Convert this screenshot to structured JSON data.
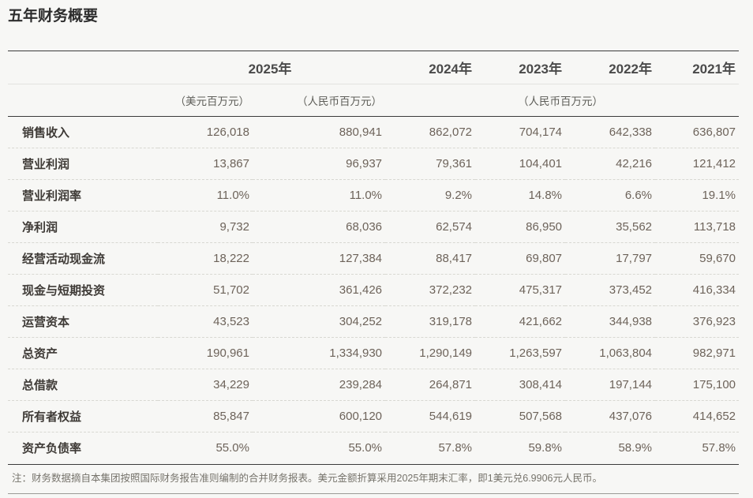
{
  "page": {
    "title": "五年财务概要"
  },
  "table": {
    "header": {
      "year_2025": "2025年",
      "years": [
        "2024年",
        "2023年",
        "2022年",
        "2021年"
      ],
      "unit_usd": "（美元百万元）",
      "unit_rmb_2025": "（人民币百万元）",
      "unit_rmb_prior": "（人民币百万元）"
    },
    "rows": [
      {
        "label": "销售收入",
        "values": [
          "126,018",
          "880,941",
          "862,072",
          "704,174",
          "642,338",
          "636,807"
        ]
      },
      {
        "label": "营业利润",
        "values": [
          "13,867",
          "96,937",
          "79,361",
          "104,401",
          "42,216",
          "121,412"
        ]
      },
      {
        "label": "营业利润率",
        "values": [
          "11.0%",
          "11.0%",
          "9.2%",
          "14.8%",
          "6.6%",
          "19.1%"
        ]
      },
      {
        "label": "净利润",
        "values": [
          "9,732",
          "68,036",
          "62,574",
          "86,950",
          "35,562",
          "113,718"
        ]
      },
      {
        "label": "经营活动现金流",
        "values": [
          "18,222",
          "127,384",
          "88,417",
          "69,807",
          "17,797",
          "59,670"
        ]
      },
      {
        "label": "现金与短期投资",
        "values": [
          "51,702",
          "361,426",
          "372,232",
          "475,317",
          "373,452",
          "416,334"
        ]
      },
      {
        "label": "运营资本",
        "values": [
          "43,523",
          "304,252",
          "319,178",
          "421,662",
          "344,938",
          "376,923"
        ]
      },
      {
        "label": "总资产",
        "values": [
          "190,961",
          "1,334,930",
          "1,290,149",
          "1,263,597",
          "1,063,804",
          "982,971"
        ]
      },
      {
        "label": "总借款",
        "values": [
          "34,229",
          "239,284",
          "264,871",
          "308,414",
          "197,144",
          "175,100"
        ]
      },
      {
        "label": "所有者权益",
        "values": [
          "85,847",
          "600,120",
          "544,619",
          "507,568",
          "437,076",
          "414,652"
        ]
      },
      {
        "label": "资产负债率",
        "values": [
          "55.0%",
          "55.0%",
          "57.8%",
          "59.8%",
          "58.9%",
          "57.8%"
        ]
      }
    ]
  },
  "footnote": "注：财务数据摘自本集团按照国际财务报告准则编制的合并财务报表。美元金额折算采用2025年期末汇率，即1美元兑6.9906元人民币。",
  "colors": {
    "page_background": "#f7f7f5",
    "dark_rule": "#3b3b3b",
    "dashed_rule": "#d8d8d2",
    "label_text": "#3e3a36",
    "value_text": "#6d635a",
    "note_text": "#76736b"
  }
}
